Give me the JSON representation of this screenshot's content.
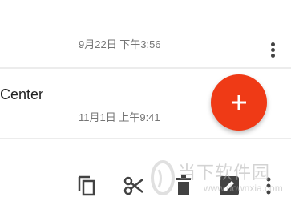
{
  "notes": [
    {
      "title": "",
      "date": "9月22日 下午3:56"
    },
    {
      "title": "Center",
      "date": "11月1日 上午9:41"
    }
  ],
  "fab": {
    "icon": "plus-icon",
    "color": "#ef3a16"
  },
  "toolbar": {
    "icons": [
      "copy-icon",
      "cut-icon",
      "delete-icon",
      "edit-icon",
      "more-vert-icon"
    ]
  },
  "watermark": {
    "text": "当下软件园",
    "url": "www.downxia.com"
  },
  "colors": {
    "accent": "#ef3a16",
    "icon": "#424242",
    "secondary_text": "#757575"
  }
}
